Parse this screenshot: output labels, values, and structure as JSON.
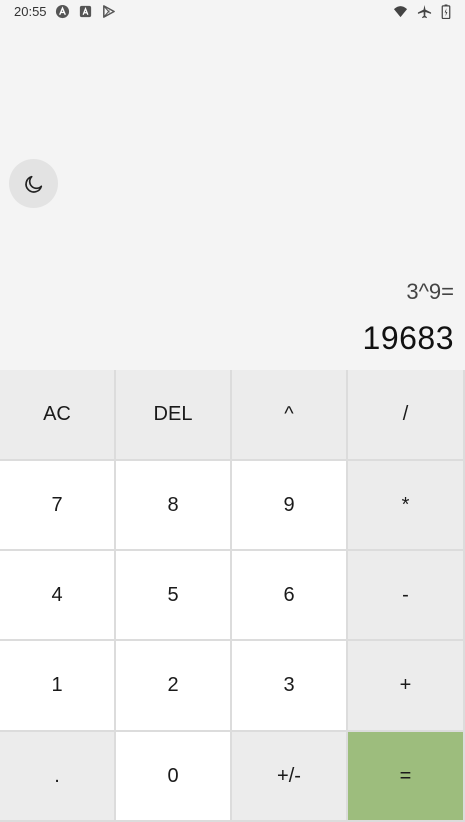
{
  "status_bar": {
    "time": "20:55",
    "left_icons": [
      "a-circle-icon",
      "a-square-icon",
      "play-store-icon"
    ],
    "right_icons": [
      "wifi-icon",
      "airplane-icon",
      "battery-icon"
    ]
  },
  "theme_toggle": {
    "icon": "moon-icon"
  },
  "display": {
    "expression": "3^9=",
    "result": "19683"
  },
  "keys": [
    {
      "label": "AC",
      "style": "gray"
    },
    {
      "label": "DEL",
      "style": "gray"
    },
    {
      "label": "^",
      "style": "gray"
    },
    {
      "label": "/",
      "style": "gray"
    },
    {
      "label": "7",
      "style": "light"
    },
    {
      "label": "8",
      "style": "light"
    },
    {
      "label": "9",
      "style": "light"
    },
    {
      "label": "*",
      "style": "gray"
    },
    {
      "label": "4",
      "style": "light"
    },
    {
      "label": "5",
      "style": "light"
    },
    {
      "label": "6",
      "style": "light"
    },
    {
      "label": "-",
      "style": "gray"
    },
    {
      "label": "1",
      "style": "light"
    },
    {
      "label": "2",
      "style": "light"
    },
    {
      "label": "3",
      "style": "light"
    },
    {
      "label": "+",
      "style": "gray"
    },
    {
      "label": ".",
      "style": "gray"
    },
    {
      "label": "0",
      "style": "light"
    },
    {
      "label": "+/-",
      "style": "gray"
    },
    {
      "label": "=",
      "style": "equals"
    }
  ],
  "colors": {
    "background": "#f4f4f4",
    "key_light": "#ffffff",
    "key_gray": "#ececec",
    "equals": "#9dbd7d"
  }
}
